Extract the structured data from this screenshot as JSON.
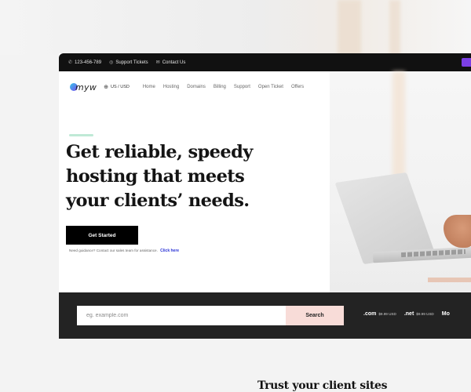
{
  "topbar": {
    "phone": "123-456-789",
    "support": "Support Tickets",
    "contact": "Contact Us"
  },
  "nav": {
    "logo": "myw",
    "language": "US / USD",
    "menu": [
      "Home",
      "Hosting",
      "Domains",
      "Billing",
      "Support",
      "Open Ticket",
      "Offers"
    ]
  },
  "hero": {
    "headline": [
      "Get reliable, speedy",
      "hosting that meets",
      "your clients’ needs."
    ],
    "cta": "Get Started",
    "help_text": "Need guidance? Contact our sales team for assistance.",
    "help_link": "Click here"
  },
  "domain_search": {
    "placeholder": "eg. example.com",
    "button": "Search",
    "tlds": [
      {
        "name": ".com",
        "price": "$9.99 USD"
      },
      {
        "name": ".net",
        "price": "$9.99 USD"
      },
      {
        "name": "Mo",
        "price": ""
      }
    ]
  },
  "section2": {
    "title": "Trust your client sites"
  },
  "colors": {
    "topbar_bg": "#111111",
    "strip_bg": "#232323",
    "search_button_bg": "#f8dcd8",
    "link": "#2a33d6",
    "accent": "#7b3fe4"
  }
}
